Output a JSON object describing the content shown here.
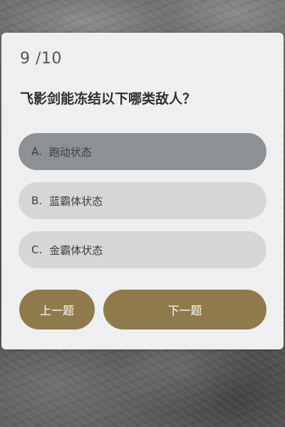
{
  "quiz": {
    "progress": "9 /10",
    "question": "飞影剑能冻结以下哪类敌人？",
    "options": [
      {
        "letter": "A.",
        "text": "跑动状态",
        "selected": true
      },
      {
        "letter": "B.",
        "text": "蓝霸体状态",
        "selected": false
      },
      {
        "letter": "C.",
        "text": "金霸体状态",
        "selected": false
      }
    ],
    "prev_label": "上一题",
    "next_label": "下一题"
  },
  "colors": {
    "card": "#eeeff1",
    "option": "#d5d6d8",
    "option_selected": "#8e9193",
    "button": "#8f7a4b",
    "button_text": "#ffffff"
  }
}
